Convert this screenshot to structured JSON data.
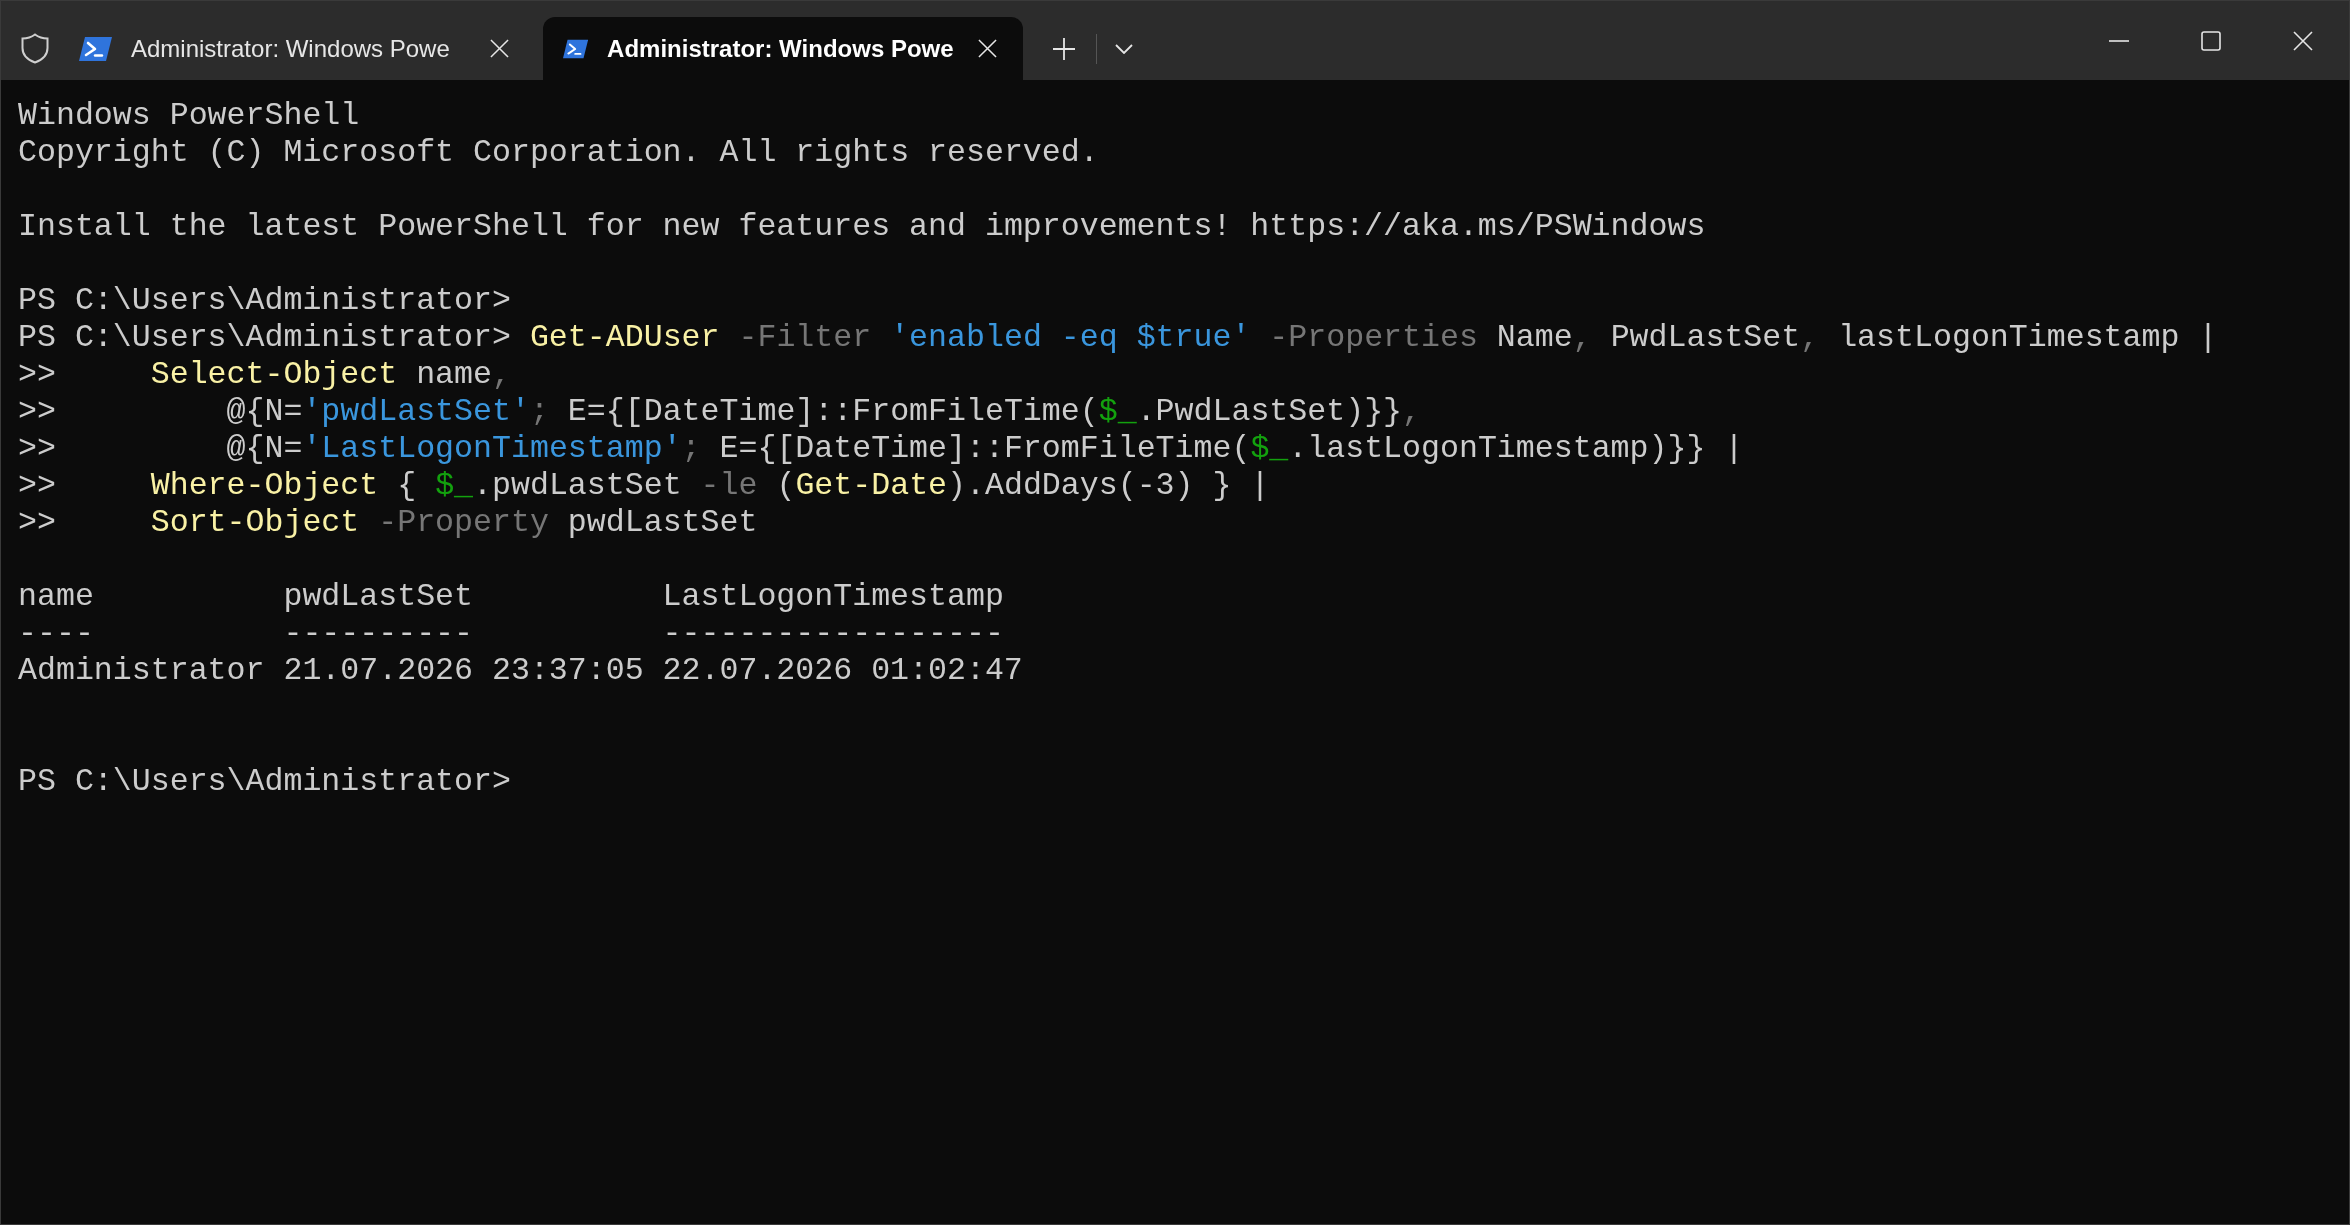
{
  "tabs": [
    {
      "title": "Administrator: Windows Powe",
      "selected": false
    },
    {
      "title": "Administrator: Windows Powe",
      "selected": true
    }
  ],
  "terminal": {
    "lines": [
      {
        "kind": "text",
        "text": "Windows PowerShell"
      },
      {
        "kind": "text",
        "text": "Copyright (C) Microsoft Corporation. All rights reserved."
      },
      {
        "kind": "blank"
      },
      {
        "kind": "text",
        "text": "Install the latest PowerShell for new features and improvements! https://aka.ms/PSWindows"
      },
      {
        "kind": "blank"
      },
      {
        "kind": "prompt",
        "prompt": "PS C:\\Users\\Administrator>"
      },
      {
        "kind": "prompt",
        "prompt": "PS C:\\Users\\Administrator>",
        "tokens": [
          {
            "kind": "command",
            "text": " Get-ADUser"
          },
          {
            "kind": "parameter",
            "text": " -Filter"
          },
          {
            "kind": "string",
            "text": " 'enabled -eq $true'"
          },
          {
            "kind": "parameter",
            "text": " -Properties"
          },
          {
            "kind": "plain",
            "text": " Name"
          },
          {
            "kind": "operator",
            "text": ","
          },
          {
            "kind": "plain",
            "text": " PwdLastSet"
          },
          {
            "kind": "operator",
            "text": ","
          },
          {
            "kind": "plain",
            "text": " lastLogonTimestamp |"
          }
        ]
      },
      {
        "kind": "continuation",
        "prompt": ">>",
        "tokens": [
          {
            "kind": "command",
            "text": "     Select-Object"
          },
          {
            "kind": "plain",
            "text": " name"
          },
          {
            "kind": "operator",
            "text": ","
          }
        ]
      },
      {
        "kind": "continuation",
        "prompt": ">>",
        "tokens": [
          {
            "kind": "plain",
            "text": "         @{N="
          },
          {
            "kind": "string",
            "text": "'pwdLastSet'"
          },
          {
            "kind": "operator",
            "text": ";"
          },
          {
            "kind": "plain",
            "text": " E={[DateTime]::FromFileTime("
          },
          {
            "kind": "variable",
            "text": "$_"
          },
          {
            "kind": "plain",
            "text": ".PwdLastSet)}}"
          },
          {
            "kind": "operator",
            "text": ","
          }
        ]
      },
      {
        "kind": "continuation",
        "prompt": ">>",
        "tokens": [
          {
            "kind": "plain",
            "text": "         @{N="
          },
          {
            "kind": "string",
            "text": "'LastLogonTimestamp'"
          },
          {
            "kind": "operator",
            "text": ";"
          },
          {
            "kind": "plain",
            "text": " E={[DateTime]::FromFileTime("
          },
          {
            "kind": "variable",
            "text": "$_"
          },
          {
            "kind": "plain",
            "text": ".lastLogonTimestamp)}} |"
          }
        ]
      },
      {
        "kind": "continuation",
        "prompt": ">>",
        "tokens": [
          {
            "kind": "command",
            "text": "     Where-Object"
          },
          {
            "kind": "plain",
            "text": " { "
          },
          {
            "kind": "variable",
            "text": "$_"
          },
          {
            "kind": "plain",
            "text": ".pwdLastSet"
          },
          {
            "kind": "operator",
            "text": " -le"
          },
          {
            "kind": "plain",
            "text": " ("
          },
          {
            "kind": "command",
            "text": "Get-Date"
          },
          {
            "kind": "plain",
            "text": ").AddDays(-3) } |"
          }
        ]
      },
      {
        "kind": "continuation",
        "prompt": ">>",
        "tokens": [
          {
            "kind": "command",
            "text": "     Sort-Object"
          },
          {
            "kind": "parameter",
            "text": " -Property"
          },
          {
            "kind": "plain",
            "text": " pwdLastSet"
          }
        ]
      },
      {
        "kind": "blank"
      },
      {
        "kind": "table",
        "columns": [
          {
            "header": "name",
            "rule": "----"
          },
          {
            "header": "pwdLastSet",
            "rule": "----------"
          },
          {
            "header": "LastLogonTimestamp",
            "rule": "------------------"
          }
        ],
        "rows": [
          [
            "Administrator",
            "21.07.2026 23:37:05",
            "22.07.2026 01:02:47"
          ]
        ]
      },
      {
        "kind": "blank"
      },
      {
        "kind": "blank"
      },
      {
        "kind": "prompt",
        "prompt": "PS C:\\Users\\Administrator>"
      }
    ]
  }
}
